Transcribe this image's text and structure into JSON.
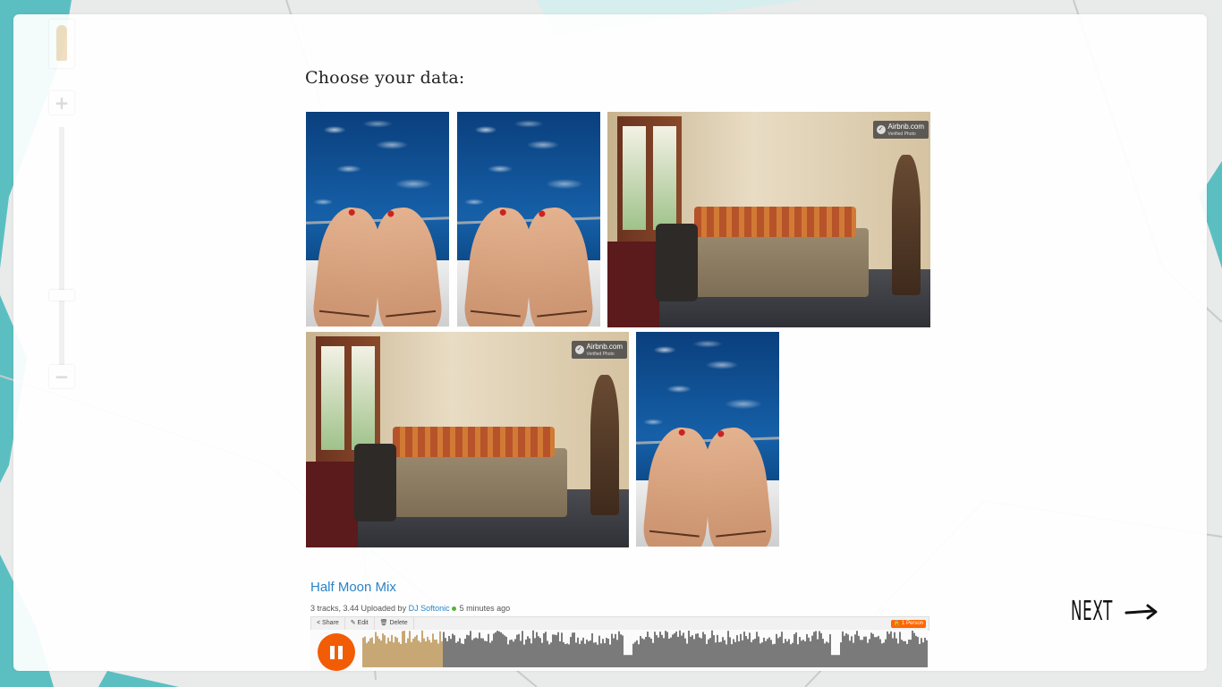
{
  "page": {
    "heading": "Choose your data:",
    "next_label": "NEXT"
  },
  "photos": [
    {
      "kind": "feet"
    },
    {
      "kind": "feet"
    },
    {
      "kind": "room",
      "badge_title": "Airbnb.com",
      "badge_sub": "Verified Photo"
    },
    {
      "kind": "room",
      "badge_title": "Airbnb.com",
      "badge_sub": "Verified Photo"
    },
    {
      "kind": "feet"
    }
  ],
  "soundcloud": {
    "title": "Half Moon Mix",
    "meta_prefix": "3 tracks, 3.44 Uploaded by",
    "uploader": "DJ Softonic",
    "time": "5 minutes ago",
    "toolbar": {
      "share": "Share",
      "edit": "Edit",
      "delete": "Delete",
      "person": "1 Person"
    },
    "progress": 0.14
  },
  "colors": {
    "accent": "#f25c05",
    "link": "#2a84c7",
    "map_water": "#5bbfc2"
  },
  "icons": {
    "pegman": "pegman-icon",
    "zoom_in": "plus-icon",
    "zoom_out": "minus-icon",
    "next": "arrow-right-icon",
    "pause": "pause-icon"
  }
}
